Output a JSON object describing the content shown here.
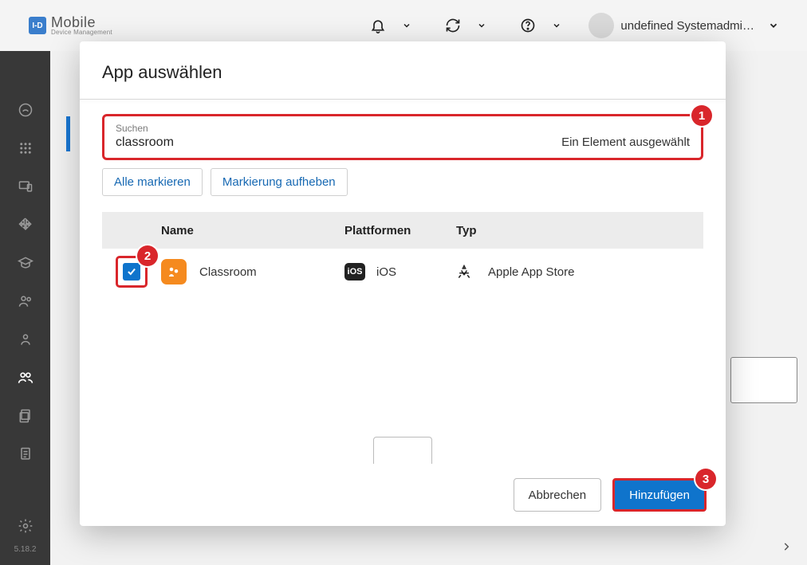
{
  "brand": {
    "logo": "I-D",
    "title": "Mobile",
    "subtitle": "Device Management"
  },
  "user": {
    "name": "undefined Systemadmi…"
  },
  "version": "5.18.2",
  "modal": {
    "title": "App auswählen",
    "search_label": "Suchen",
    "search_value": "classroom",
    "selected_text": "Ein Element ausgewählt",
    "select_all": "Alle markieren",
    "deselect_all": "Markierung aufheben",
    "columns": {
      "name": "Name",
      "platforms": "Plattformen",
      "type": "Typ"
    },
    "rows": [
      {
        "checked": true,
        "name": "Classroom",
        "platform_badge": "iOS",
        "platform": "iOS",
        "type": "Apple App Store"
      }
    ],
    "cancel": "Abbrechen",
    "submit": "Hinzufügen"
  },
  "callouts": {
    "one": "1",
    "two": "2",
    "three": "3"
  }
}
